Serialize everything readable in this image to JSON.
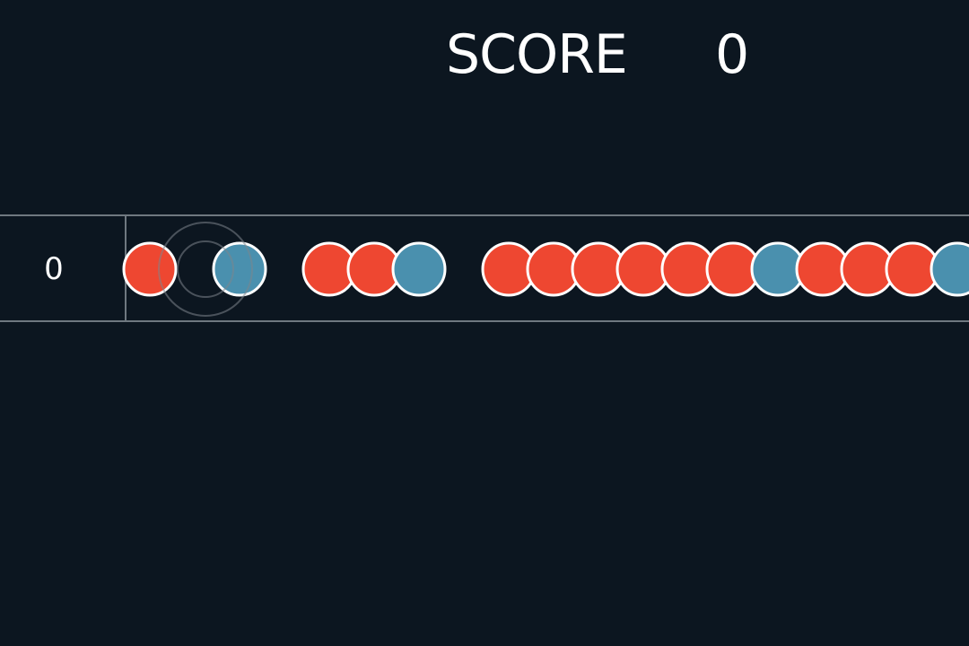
{
  "hud": {
    "score_label": "SCORE",
    "score_value": "0"
  },
  "lane": {
    "count": "0"
  },
  "colors": {
    "background": "#0c1620",
    "red_bead": "#ee4731",
    "blue_bead": "#4a90ae",
    "bead_outline": "#ffffff",
    "track_line": "#6f7880"
  },
  "beads": [
    "red",
    "blue",
    "red",
    "red",
    "blue",
    "red",
    "red",
    "red",
    "red",
    "red",
    "red",
    "blue",
    "red",
    "red",
    "red",
    "blue"
  ]
}
